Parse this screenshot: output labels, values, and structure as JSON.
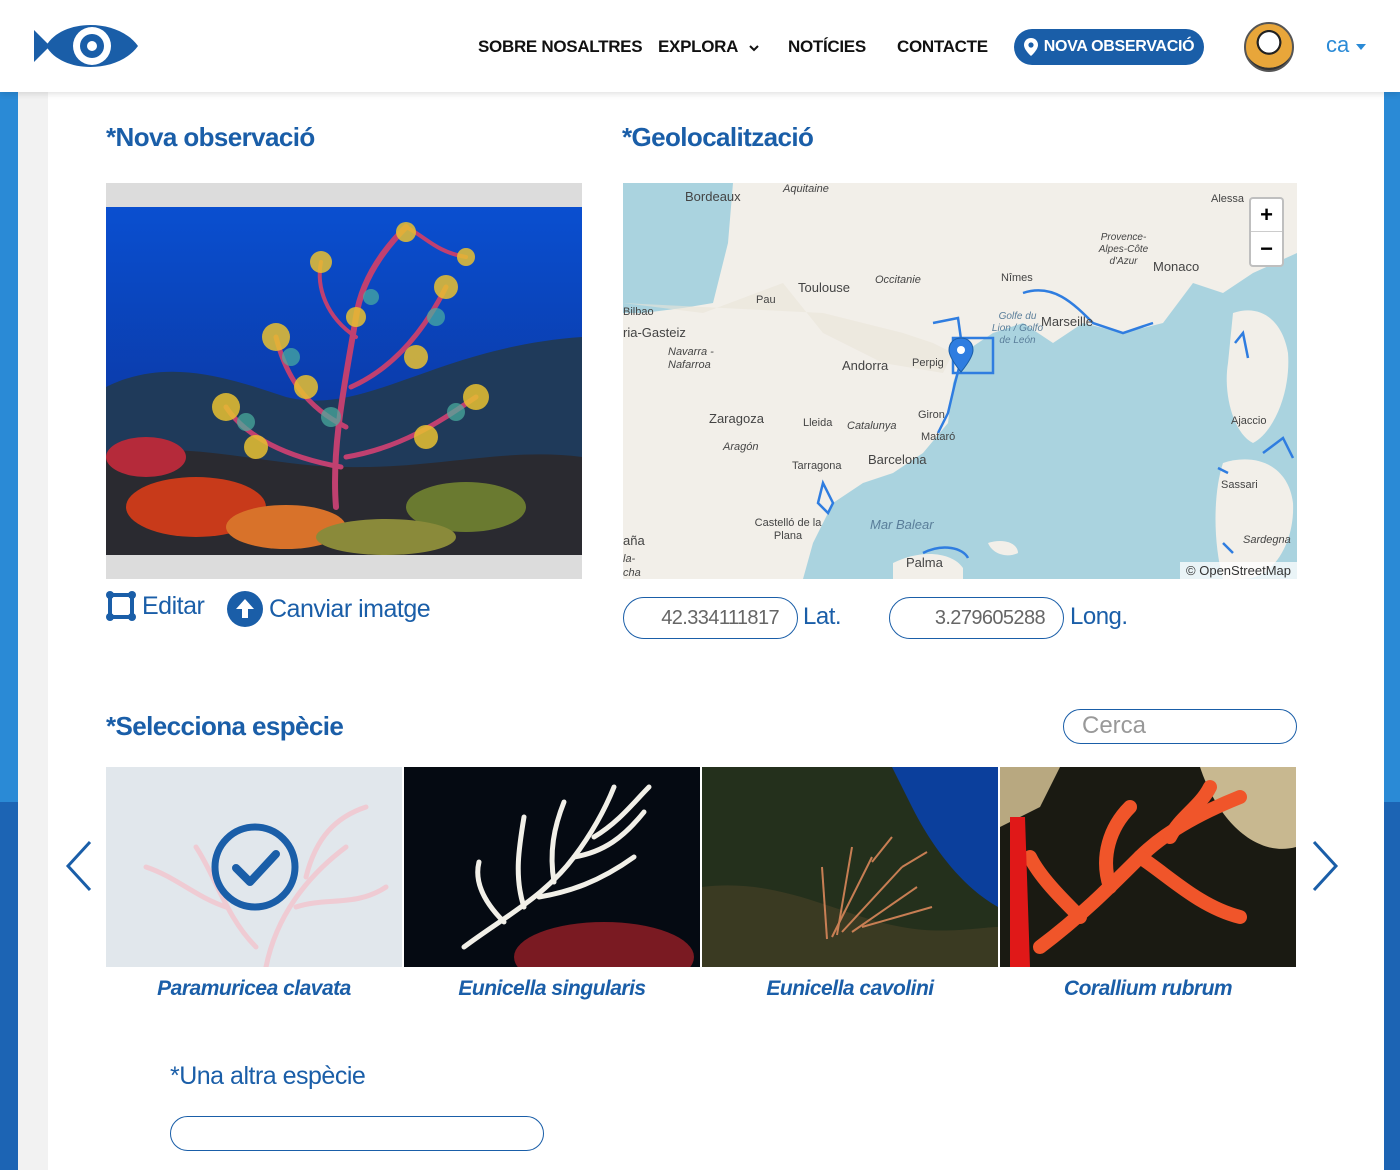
{
  "header": {
    "nav": [
      "SOBRE NOSALTRES",
      "EXPLORA",
      "NOTÍCIES",
      "CONTACTE"
    ],
    "cta_label": "NOVA OBSERVACIÓ",
    "lang": "ca"
  },
  "observation": {
    "title": "*Nova observació",
    "edit_label": "Editar",
    "change_image_label": "Canviar imatge"
  },
  "geo": {
    "title": "*Geolocalització",
    "lat_value": "42.334111817",
    "lat_label": "Lat.",
    "long_value": "3.279605288",
    "long_label": "Long.",
    "attribution": "© OpenStreetMap",
    "places": [
      "Bordeaux",
      "Aquitaine",
      "Toulouse",
      "Occitanie",
      "Pau",
      "Bilbao",
      "ria-Gasteiz",
      "Navarra - Nafarroa",
      "Andorra",
      "Perpig",
      "Zaragoza",
      "Aragón",
      "Lleida",
      "Catalunya",
      "Giron",
      "Mataró",
      "Tarragona",
      "Barcelona",
      "Castelló de la Plana",
      "Mar Balear",
      "Palma",
      "Nîmes",
      "Marseille",
      "Provence-Alpes-Côte d'Azur",
      "Monaco",
      "Alessa",
      "Golfe du Lion / Golfo de León",
      "Ajaccio",
      "Sassari",
      "Sardegna",
      "aña",
      "la-",
      "cha"
    ]
  },
  "species": {
    "title": "*Selecciona espècie",
    "search_placeholder": "Cerca",
    "cards": [
      {
        "name": "Paramuricea clavata",
        "selected": true
      },
      {
        "name": "Eunicella singularis",
        "selected": false
      },
      {
        "name": "Eunicella cavolini",
        "selected": false
      },
      {
        "name": "Corallium rubrum",
        "selected": false
      }
    ],
    "other_label": "*Una altra espècie"
  },
  "colors": {
    "brand": "#1a5ea8",
    "accent": "#2a8ad6"
  }
}
